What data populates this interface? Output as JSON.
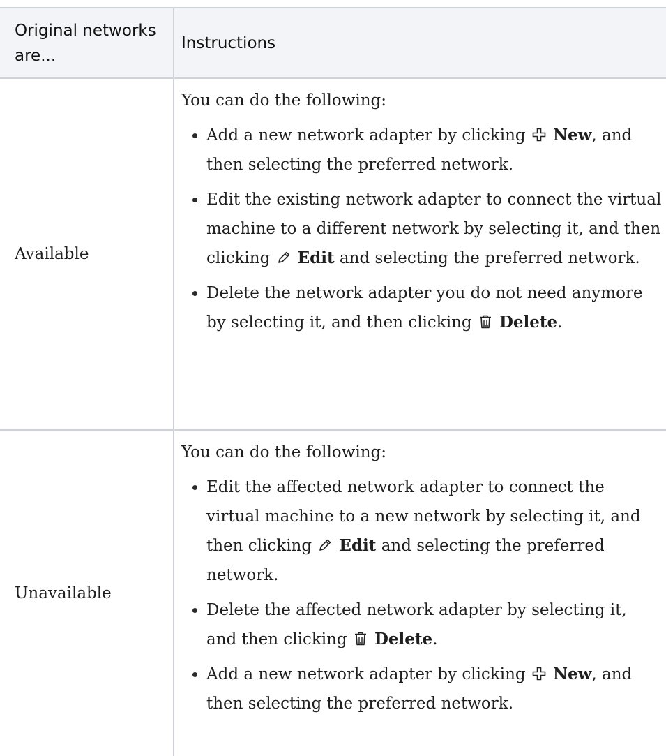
{
  "table": {
    "headers": {
      "col1": "Original networks are...",
      "col2": "Instructions"
    },
    "rows": [
      {
        "state": "Available",
        "lead": "You can do the following:",
        "bullets": [
          {
            "pre": "Add a new network adapter by clicking",
            "icon": "plus-icon",
            "button": "New",
            "post": ", and then selecting the preferred network."
          },
          {
            "pre": "Edit the existing network adapter to connect the virtual machine to a different network by selecting it, and then clicking",
            "icon": "pencil-icon",
            "button": "Edit",
            "post": " and selecting the preferred network."
          },
          {
            "pre": "Delete the network adapter you do not need anymore by selecting it, and then clicking",
            "icon": "trash-icon",
            "button": "Delete",
            "post": "."
          }
        ]
      },
      {
        "state": "Unavailable",
        "lead": "You can do the following:",
        "bullets": [
          {
            "pre": "Edit the affected network adapter to connect the virtual machine to a new network by selecting it, and then clicking",
            "icon": "pencil-icon",
            "button": "Edit",
            "post": " and selecting the preferred network."
          },
          {
            "pre": "Delete the affected network adapter by selecting it, and then clicking",
            "icon": "trash-icon",
            "button": "Delete",
            "post": "."
          },
          {
            "pre": "Add a new network adapter by clicking",
            "icon": "plus-icon",
            "button": "New",
            "post": ", and then selecting the preferred network."
          }
        ]
      }
    ]
  },
  "colors": {
    "header_background": "#f2f4f8",
    "border": "#cfd2d7",
    "text": "#1f1f1f"
  }
}
